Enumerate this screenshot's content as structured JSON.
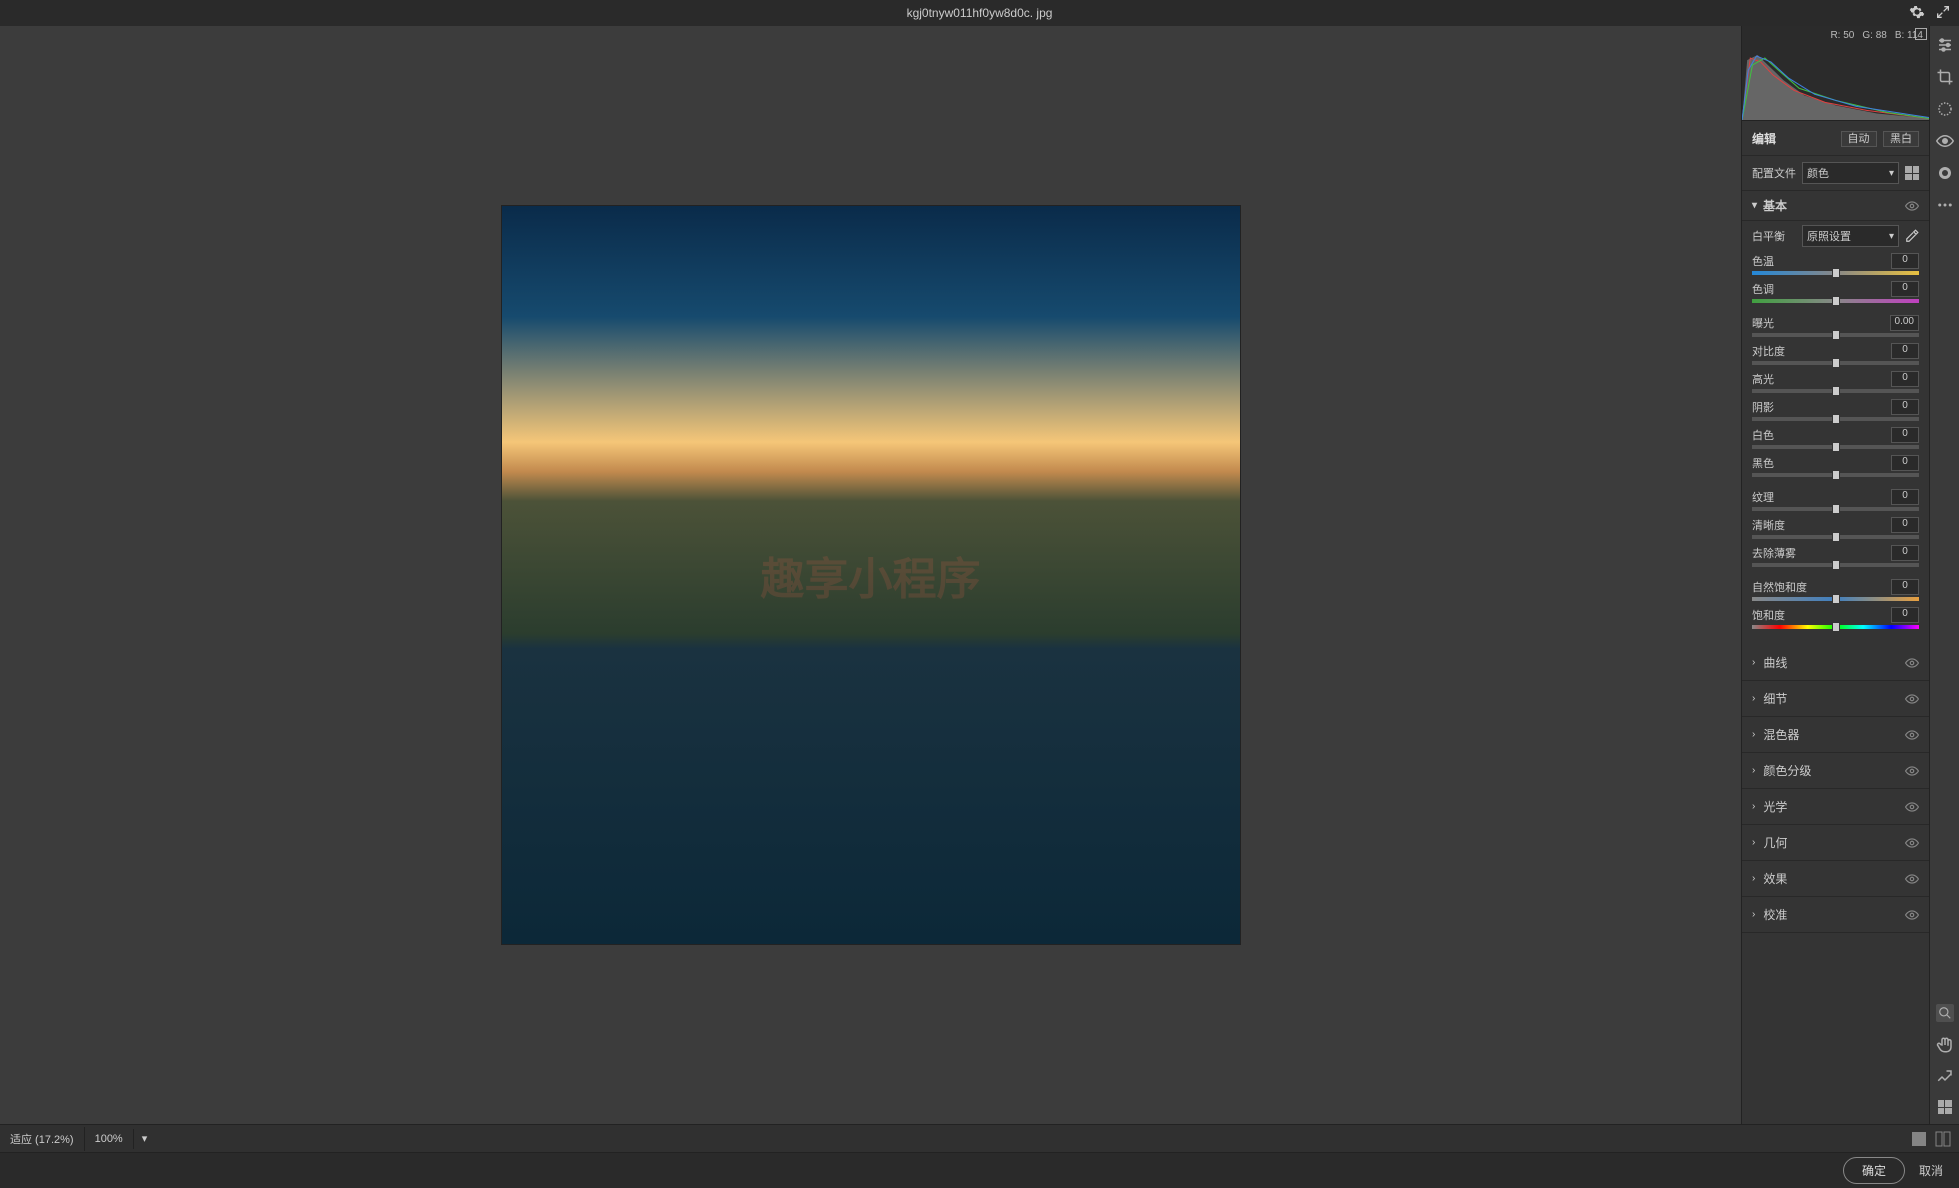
{
  "titlebar": {
    "filename": "kgj0tnyw011hf0yw8d0c. jpg"
  },
  "histogram": {
    "r": "R: 50",
    "g": "G: 88",
    "b": "B: 114"
  },
  "edit": {
    "label": "编辑",
    "auto": "自动",
    "bw": "黑白"
  },
  "profile": {
    "label": "配置文件",
    "value": "颜色"
  },
  "basic": {
    "title": "基本",
    "wb_label": "白平衡",
    "wb_value": "原照设置",
    "sliders": {
      "temp": {
        "label": "色温",
        "value": "0"
      },
      "tint": {
        "label": "色调",
        "value": "0"
      },
      "exposure": {
        "label": "曝光",
        "value": "0.00"
      },
      "contrast": {
        "label": "对比度",
        "value": "0"
      },
      "highlights": {
        "label": "高光",
        "value": "0"
      },
      "shadows": {
        "label": "阴影",
        "value": "0"
      },
      "whites": {
        "label": "白色",
        "value": "0"
      },
      "blacks": {
        "label": "黑色",
        "value": "0"
      },
      "texture": {
        "label": "纹理",
        "value": "0"
      },
      "clarity": {
        "label": "清晰度",
        "value": "0"
      },
      "dehaze": {
        "label": "去除薄雾",
        "value": "0"
      },
      "vibrance": {
        "label": "自然饱和度",
        "value": "0"
      },
      "saturation": {
        "label": "饱和度",
        "value": "0"
      }
    }
  },
  "sections": {
    "curve": "曲线",
    "detail": "细节",
    "mixer": "混色器",
    "grading": "颜色分级",
    "optics": "光学",
    "geometry": "几何",
    "effects": "效果",
    "calibration": "校准"
  },
  "footer": {
    "fit": "适应 (17.2%)",
    "zoom100": "100%"
  },
  "actions": {
    "ok": "确定",
    "cancel": "取消"
  },
  "watermark": "趣享小程序"
}
